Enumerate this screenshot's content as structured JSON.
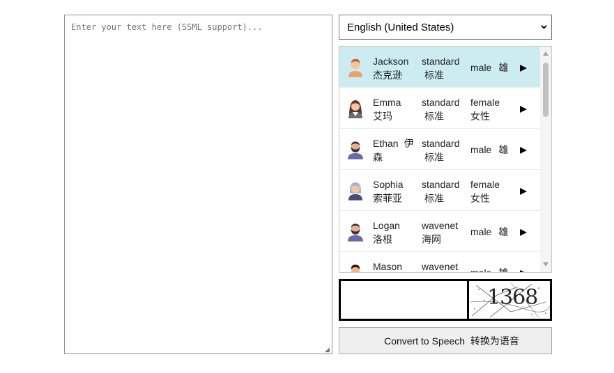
{
  "editor": {
    "placeholder": "Enter your text here (SSML support)..."
  },
  "language_select": {
    "selected": "English (United States)"
  },
  "voices": [
    {
      "name": "Jackson",
      "name_zh": "杰克逊",
      "type": "standard",
      "type_zh": "标准",
      "gender": "male",
      "gender_zh": "雄",
      "avatar": "man-light-hair-avatar",
      "selected": true
    },
    {
      "name": "Emma",
      "name_zh": "艾玛",
      "type": "standard",
      "type_zh": "标准",
      "gender": "female",
      "gender_zh": "女性",
      "avatar": "woman-dark-hair-avatar",
      "selected": false
    },
    {
      "name": "Ethan",
      "name_zh": "伊",
      "name_zh2": "森",
      "type": "standard",
      "type_zh": "标准",
      "gender": "male",
      "gender_zh": "雄",
      "avatar": "bearded-man-avatar",
      "selected": false
    },
    {
      "name": "Sophia",
      "name_zh": "索菲亚",
      "type": "standard",
      "type_zh": "标准",
      "gender": "female",
      "gender_zh": "女性",
      "avatar": "old-woman-avatar",
      "selected": false
    },
    {
      "name": "Logan",
      "name_zh": "洛根",
      "type": "wavenet",
      "type_zh": "海网",
      "gender": "male",
      "gender_zh": "雄",
      "avatar": "bearded-man-avatar",
      "selected": false
    },
    {
      "name": "Mason",
      "name_zh": "",
      "type": "wavenet",
      "type_zh": "",
      "gender": "male",
      "gender_zh": "雄",
      "avatar": "young-man-avatar",
      "selected": false
    }
  ],
  "captcha": {
    "code": "1368"
  },
  "convert_button": {
    "label": "Convert to Speech  转换为语音"
  },
  "colors": {
    "selected_row": "#cdecf2",
    "border": "#8f8f8f",
    "button_bg": "#efefef"
  }
}
